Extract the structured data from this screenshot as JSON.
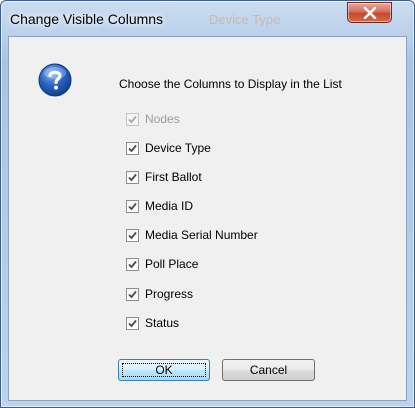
{
  "window": {
    "title": "Change Visible Columns",
    "ghost_title": "Device Type"
  },
  "dialog": {
    "heading": "Choose the Columns to Display in the List",
    "icon": "question-icon",
    "columns": [
      {
        "label": "Nodes",
        "checked": true,
        "disabled": true
      },
      {
        "label": "Device Type",
        "checked": true,
        "disabled": false
      },
      {
        "label": "First Ballot",
        "checked": true,
        "disabled": false
      },
      {
        "label": "Media ID",
        "checked": true,
        "disabled": false
      },
      {
        "label": "Media Serial Number",
        "checked": true,
        "disabled": false
      },
      {
        "label": "Poll Place",
        "checked": true,
        "disabled": false
      },
      {
        "label": "Progress",
        "checked": true,
        "disabled": false
      },
      {
        "label": "Status",
        "checked": true,
        "disabled": false
      }
    ],
    "ok_label": "OK",
    "cancel_label": "Cancel"
  },
  "colors": {
    "title_bar": "#b9d1ea",
    "close_button": "#c4492e",
    "icon_blue": "#2156b8"
  }
}
